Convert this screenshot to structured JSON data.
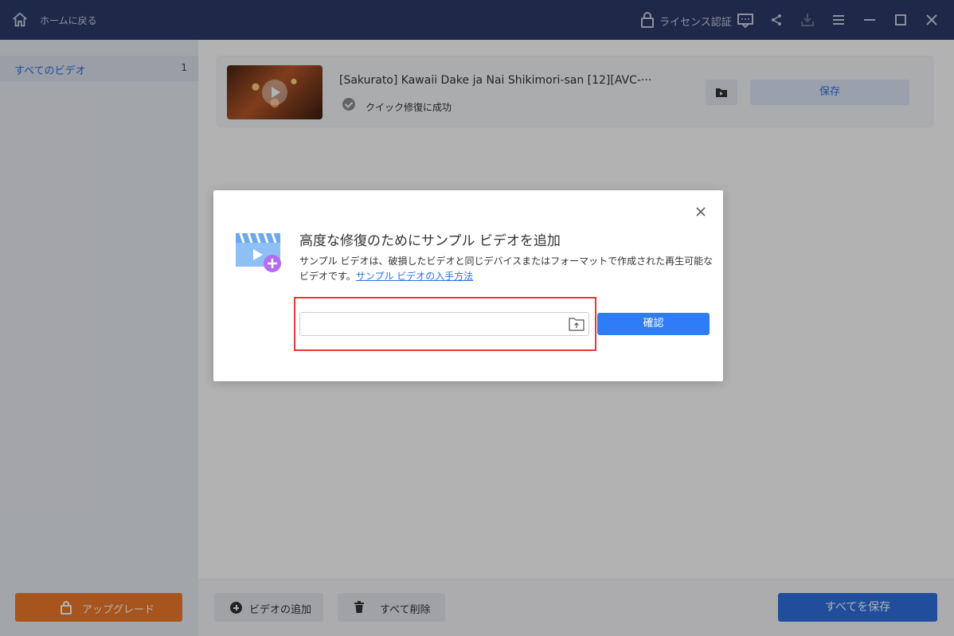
{
  "titlebar": {
    "home_label": "ホームに戻る",
    "license_label": "ライセンス認証",
    "icons": [
      "home-icon",
      "lock-icon",
      "feedback-icon",
      "share-icon",
      "download-icon",
      "menu-icon",
      "minimize-icon",
      "maximize-icon",
      "close-icon"
    ]
  },
  "sidebar": {
    "items": [
      {
        "label": "すべてのビデオ",
        "count": "1"
      }
    ],
    "upgrade_label": "アップグレード"
  },
  "main": {
    "videos": [
      {
        "title": "[Sakurato] Kawaii Dake ja Nai Shikimori-san [12][AVC-···",
        "status": "クイック修復に成功",
        "save_label": "保存"
      }
    ],
    "bottom": {
      "add_label": "ビデオの追加",
      "delete_all_label": "すべて削除",
      "save_all_label": "すべてを保存"
    }
  },
  "dialog": {
    "title": "高度な修復のためにサンプル ビデオを追加",
    "description": "サンプル ビデオは、破損したビデオと同じデバイスまたはフォーマットで作成された再生可能なビデオです。",
    "link_text": "サンプル ビデオの入手方法",
    "input_value": "",
    "confirm_label": "確認"
  },
  "colors": {
    "titlebar": "#2b3a67",
    "accent": "#2f6fe0",
    "upgrade": "#f07a2a",
    "highlight": "#e53935"
  }
}
